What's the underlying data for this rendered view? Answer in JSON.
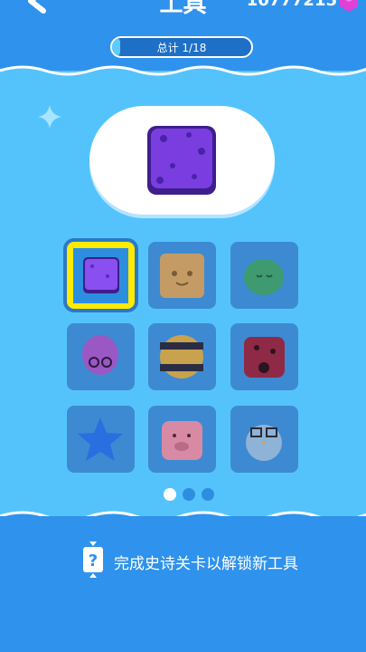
{
  "header": {
    "title": "工具",
    "coin_count": "10777215",
    "back_icon": "back-arrow-icon",
    "gem_icon": "gem-icon"
  },
  "progress": {
    "label": "总计 1/18",
    "fraction": 0.0556
  },
  "preview": {
    "item_name": "purple-jelly-block"
  },
  "tools": [
    {
      "name": "purple-jelly-block",
      "selected": true
    },
    {
      "name": "toast-block",
      "selected": false
    },
    {
      "name": "green-cactus-blob",
      "selected": false
    },
    {
      "name": "purple-balloon-glasses",
      "selected": false
    },
    {
      "name": "striped-bee-ball",
      "selected": false
    },
    {
      "name": "ladybug-block",
      "selected": false
    },
    {
      "name": "blue-star",
      "selected": false
    },
    {
      "name": "pig-block",
      "selected": false
    },
    {
      "name": "penguin-glasses",
      "selected": false
    }
  ],
  "pagination": {
    "pages": 3,
    "current": 1
  },
  "hint": {
    "text": "完成史诗关卡以解锁新工具",
    "icon": "question-hourglass-icon"
  },
  "colors": {
    "dark_blue": "#2f92ec",
    "light_blue": "#55c3fb",
    "selected_frame": "#ffea00"
  }
}
